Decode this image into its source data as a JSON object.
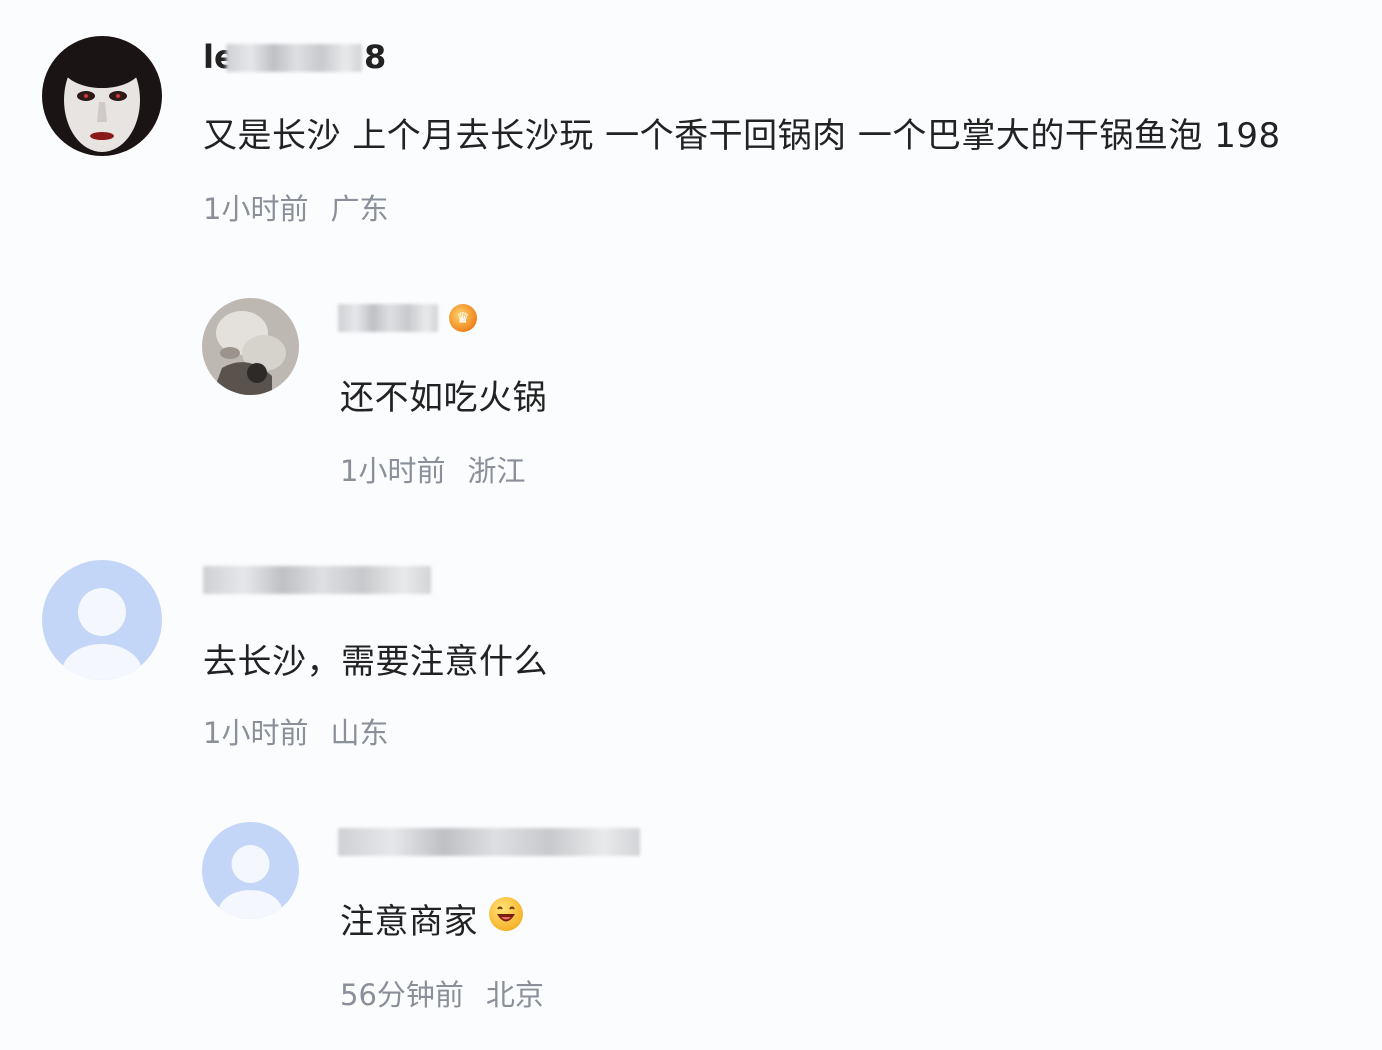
{
  "comments": [
    {
      "username_prefix": "le",
      "username_suffix": "8",
      "text": "又是长沙 上个月去长沙玩 一个香干回锅肉 一个巴掌大的干锅鱼泡 198",
      "time": "1小时前",
      "location": "广东",
      "avatar": "dark-face-avatar"
    },
    {
      "text": "还不如吃火锅",
      "time": "1小时前",
      "location": "浙江",
      "avatar": "photo-avatar",
      "badge": "crown-badge-icon"
    },
    {
      "text": "去长沙，需要注意什么",
      "time": "1小时前",
      "location": "山东",
      "avatar": "default-user-avatar"
    },
    {
      "text": "注意商家",
      "emoji": "laughing-emoji-icon",
      "time": "56分钟前",
      "location": "北京",
      "avatar": "default-user-avatar"
    }
  ],
  "colors": {
    "background": "#fbfcfe",
    "text": "#222222",
    "meta": "#8a8f99",
    "default_avatar": "#c4d6f7"
  }
}
